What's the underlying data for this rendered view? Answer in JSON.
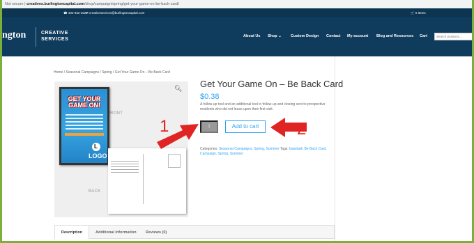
{
  "browser": {
    "warning": "Not secure",
    "host": "creatives.burlingtoncapital.com",
    "path": "/shop/campaign/spring/get-your-game-on-be-back-card/"
  },
  "topbar": {
    "phone": "402-932-2627",
    "email": "creativeservices@burlingtoncapital.com",
    "cart": "0 Items"
  },
  "header": {
    "logo_text": "ngton",
    "logo_tag_line1": "CREATIVE",
    "logo_tag_line2": "SERVICES",
    "nav": [
      "About Us",
      "Shop ⌄",
      "Custom Design",
      "Contact",
      "My account",
      "Blog and Resources",
      "Cart"
    ],
    "search_placeholder": "Search products..."
  },
  "breadcrumb": "Home / Seasonal Campaigns / Spring / Get Your Game On – Be Back Card",
  "gallery": {
    "front_label": "FRONT",
    "back_label": "BACK",
    "card_headline": "GET YOUR GAME ON!",
    "card_logo": "LOGO",
    "card_logo_mark": "L"
  },
  "product": {
    "title": "Get Your Game On – Be Back Card",
    "price": "$0.38",
    "description": "A follow-up tool and an additional tool in follow-up and closing sent to prospective residents who did not lease upon their first visit.",
    "quantity": "1",
    "add_to_cart": "Add to cart",
    "categories_label": "Categories:",
    "categories": "Seasonal Campaigns, Spring, Summer",
    "tags_label": " Tags:",
    "tags": "baseball, Be Back Card, Campaign, Spring, Summer"
  },
  "annotations": {
    "label1": "1",
    "label2": "2",
    "arrow_color": "#e02424"
  },
  "tabs": [
    "Description",
    "Additional information",
    "Reviews (0)"
  ],
  "colors": {
    "accent": "#2ea3f2",
    "header": "#0f3b5c",
    "page_border": "#7bb03a"
  }
}
